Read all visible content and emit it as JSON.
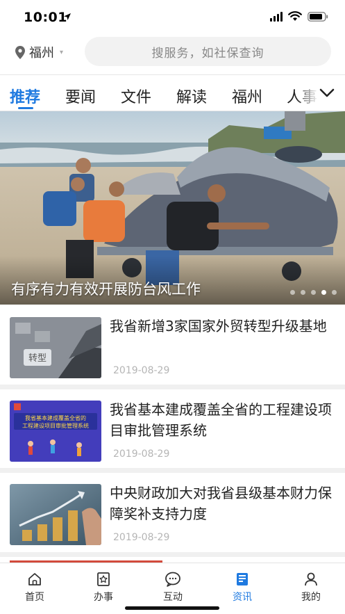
{
  "status": {
    "time": "10:01"
  },
  "location": {
    "city": "福州"
  },
  "search": {
    "placeholder": "搜服务，如社保查询"
  },
  "tabs": [
    {
      "label": "推荐",
      "active": true
    },
    {
      "label": "要闻"
    },
    {
      "label": "文件"
    },
    {
      "label": "解读"
    },
    {
      "label": "福州"
    },
    {
      "label": "人事"
    }
  ],
  "banner": {
    "title": "有序有力有效开展防台风工作",
    "slides": 5,
    "active_slide": 4
  },
  "news": [
    {
      "title": "我省新增3家国家外贸转型升级基地",
      "date": "2019-08-29",
      "thumb_text": "转型"
    },
    {
      "title": "我省基本建成覆盖全省的工程建设项目审批管理系统",
      "date": "2019-08-29",
      "thumb_text": "我省基本建成覆盖全省的\n工程建设项目审批管理系统"
    },
    {
      "title": "中央财政加大对我省县级基本财力保障奖补支持力度",
      "date": "2019-08-29",
      "thumb_text": ""
    }
  ],
  "bottom_nav": [
    {
      "label": "首页",
      "icon": "home-icon"
    },
    {
      "label": "办事",
      "icon": "star-doc-icon"
    },
    {
      "label": "互动",
      "icon": "chat-icon"
    },
    {
      "label": "资讯",
      "icon": "news-icon",
      "active": true
    },
    {
      "label": "我的",
      "icon": "user-icon"
    }
  ],
  "colors": {
    "accent": "#1f7ae0",
    "separator": "#f0f0f0"
  }
}
